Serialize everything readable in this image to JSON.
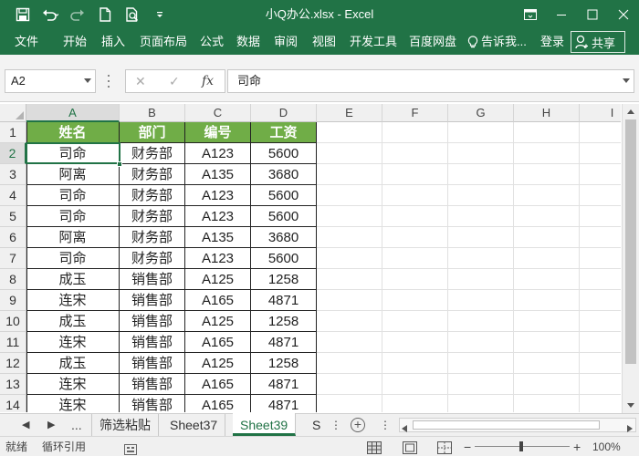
{
  "window": {
    "title": "小Q办公.xlsx  -  Excel",
    "accent": "#217346"
  },
  "ribbon": {
    "tabs": [
      "文件",
      "开始",
      "插入",
      "页面布局",
      "公式",
      "数据",
      "审阅",
      "视图",
      "开发工具",
      "百度网盘"
    ],
    "tell_me": "告诉我...",
    "login": "登录",
    "share": "共享"
  },
  "formula_bar": {
    "name_box": "A2",
    "fx_label": "fx",
    "content": "司命"
  },
  "grid": {
    "columns": [
      "A",
      "B",
      "C",
      "D",
      "E",
      "F",
      "G",
      "H",
      "I"
    ],
    "rows": [
      "1",
      "2",
      "3",
      "4",
      "5",
      "6",
      "7",
      "8",
      "9",
      "10",
      "11",
      "12",
      "13",
      "14"
    ],
    "table_header": [
      "姓名",
      "部门",
      "编号",
      "工资"
    ],
    "table_rows": [
      [
        "司命",
        "财务部",
        "A123",
        "5600"
      ],
      [
        "阿离",
        "财务部",
        "A135",
        "3680"
      ],
      [
        "司命",
        "财务部",
        "A123",
        "5600"
      ],
      [
        "司命",
        "财务部",
        "A123",
        "5600"
      ],
      [
        "阿离",
        "财务部",
        "A135",
        "3680"
      ],
      [
        "司命",
        "财务部",
        "A123",
        "5600"
      ],
      [
        "成玉",
        "销售部",
        "A125",
        "1258"
      ],
      [
        "连宋",
        "销售部",
        "A165",
        "4871"
      ],
      [
        "成玉",
        "销售部",
        "A125",
        "1258"
      ],
      [
        "连宋",
        "销售部",
        "A165",
        "4871"
      ],
      [
        "成玉",
        "销售部",
        "A125",
        "1258"
      ],
      [
        "连宋",
        "销售部",
        "A165",
        "4871"
      ],
      [
        "连宋",
        "销售部",
        "A165",
        "4871"
      ]
    ],
    "header_fill": "#70ad47",
    "selected_cell": "A2"
  },
  "sheets": {
    "ellipsis": "...",
    "tabs": [
      "筛选粘贴",
      "Sheet37",
      "Sheet39",
      "S"
    ],
    "active": "Sheet39"
  },
  "status": {
    "ready": "就绪",
    "circular": "循环引用",
    "zoom": "100%"
  }
}
